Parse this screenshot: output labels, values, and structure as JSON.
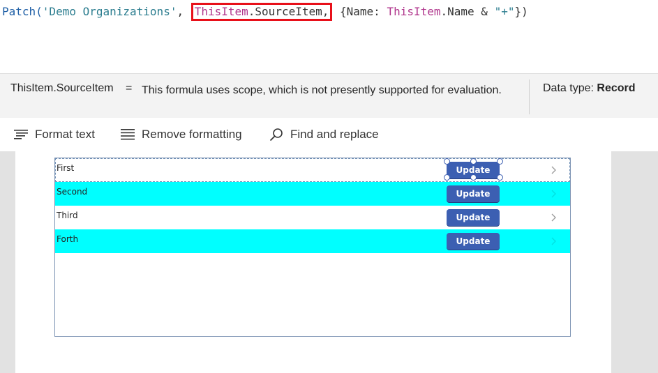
{
  "formula": {
    "fn": "Patch(",
    "str": "'Demo Organizations'",
    "comma1": ", ",
    "hl_kw": "ThisItem",
    "hl_rest": ".SourceItem,",
    "open": " {Name: ",
    "kw2": "ThisItem",
    "rest2": ".Name & ",
    "str2": "\"+\"",
    "close": "})"
  },
  "evaluation": {
    "expression": "ThisItem.SourceItem",
    "equals": "=",
    "message": "This formula uses scope, which is not presently supported for evaluation.",
    "datatype_label": "Data type:",
    "datatype_value": "Record"
  },
  "toolbar": {
    "format_text": "Format text",
    "remove_formatting": "Remove formatting",
    "find_replace": "Find and replace"
  },
  "gallery": {
    "button_label": "Update",
    "rows": [
      {
        "label": "First"
      },
      {
        "label": "Second"
      },
      {
        "label": "Third"
      },
      {
        "label": "Forth"
      }
    ]
  },
  "colors": {
    "row_alt": "#00ffff",
    "button": "#3c5fb2",
    "highlight_box": "#e8101a"
  }
}
